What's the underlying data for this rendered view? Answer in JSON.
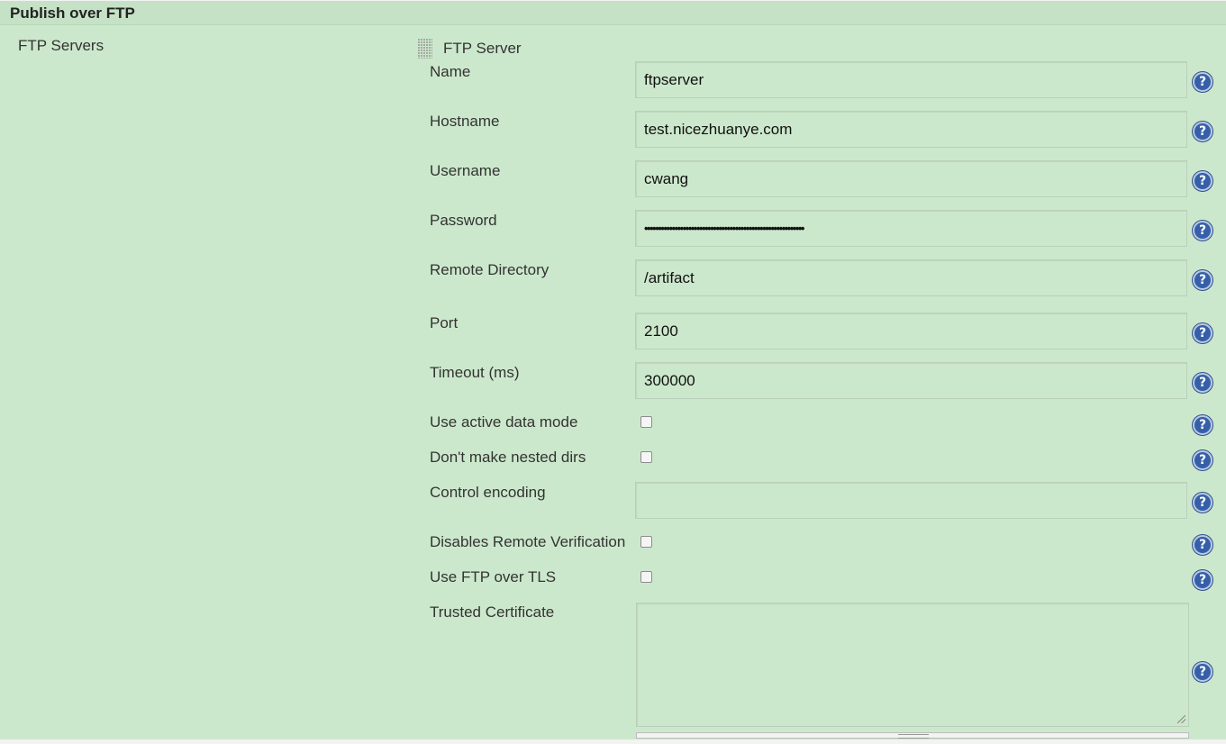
{
  "section": {
    "title": "Publish over FTP"
  },
  "ftp_servers_label": "FTP Servers",
  "server": {
    "header_label": "FTP Server",
    "fields": {
      "name": {
        "label": "Name",
        "value": "ftpserver"
      },
      "hostname": {
        "label": "Hostname",
        "value": "test.nicezhuanye.com"
      },
      "username": {
        "label": "Username",
        "value": "cwang"
      },
      "password": {
        "label": "Password",
        "value": "••••••••••••••••••••••••••••••••••••••••••••••••••••••••••"
      },
      "remote_directory": {
        "label": "Remote Directory",
        "value": "/artifact"
      },
      "port": {
        "label": "Port",
        "value": "2100"
      },
      "timeout": {
        "label": "Timeout (ms)",
        "value": "300000"
      },
      "active_data_mode": {
        "label": "Use active data mode",
        "checked": false
      },
      "no_nested_dirs": {
        "label": "Don't make nested dirs",
        "checked": false
      },
      "control_encoding": {
        "label": "Control encoding",
        "value": ""
      },
      "disable_remote_verification": {
        "label": "Disables Remote Verification",
        "checked": false
      },
      "ftp_over_tls": {
        "label": "Use FTP over TLS",
        "checked": false
      },
      "trusted_certificate": {
        "label": "Trusted Certificate",
        "value": ""
      }
    }
  },
  "help_icon": {
    "glyph": "?",
    "icon": "question-mark-icon"
  },
  "colors": {
    "panel_background": "#cce8cc",
    "help_icon": "#3560a8"
  }
}
